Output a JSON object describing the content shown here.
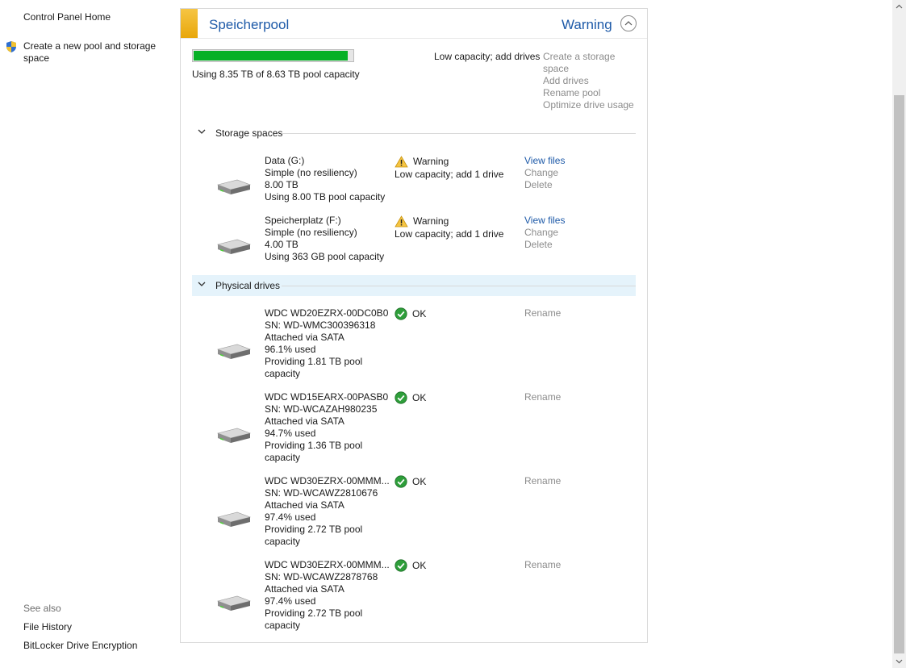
{
  "nav": {
    "home": "Control Panel Home",
    "create": "Create a new pool and storage space",
    "see_also": "See also",
    "file_history": "File History",
    "bitlocker": "BitLocker Drive Encryption"
  },
  "pool": {
    "title": "Speicherpool",
    "status": "Warning",
    "capacity_used_fraction": 0.968,
    "capacity_text": "Using 8.35 TB of 8.63 TB pool capacity",
    "low_capacity": "Low capacity; add drives",
    "actions": {
      "create_line1": "Create a storage",
      "create_line2": "space",
      "add_drives": "Add drives",
      "rename": "Rename pool",
      "optimize": "Optimize drive usage"
    }
  },
  "sections": {
    "storage_spaces": "Storage spaces",
    "physical_drives": "Physical drives"
  },
  "spaces": [
    {
      "name": "Data (G:)",
      "resiliency": "Simple (no resiliency)",
      "size": "8.00 TB",
      "usage": "Using 8.00 TB pool capacity",
      "status": "Warning",
      "status_detail": "Low capacity; add 1 drive",
      "view_files": "View files",
      "change": "Change",
      "delete": "Delete"
    },
    {
      "name": "Speicherplatz (F:)",
      "resiliency": "Simple (no resiliency)",
      "size": "4.00 TB",
      "usage": "Using 363 GB pool capacity",
      "status": "Warning",
      "status_detail": "Low capacity; add 1 drive",
      "view_files": "View files",
      "change": "Change",
      "delete": "Delete"
    }
  ],
  "drives": [
    {
      "model": "WDC WD20EZRX-00DC0B0",
      "serial": "SN: WD-WMC300396318",
      "attached": "Attached via SATA",
      "used": "96.1% used",
      "providing1": "Providing 1.81 TB pool",
      "providing2": "capacity",
      "status": "OK",
      "rename": "Rename"
    },
    {
      "model": "WDC WD15EARX-00PASB0",
      "serial": "SN: WD-WCAZAH980235",
      "attached": "Attached via SATA",
      "used": "94.7% used",
      "providing1": "Providing 1.36 TB pool",
      "providing2": "capacity",
      "status": "OK",
      "rename": "Rename"
    },
    {
      "model": "WDC WD30EZRX-00MMM...",
      "serial": "SN: WD-WCAWZ2810676",
      "attached": "Attached via SATA",
      "used": "97.4% used",
      "providing1": "Providing 2.72 TB pool",
      "providing2": "capacity",
      "status": "OK",
      "rename": "Rename"
    },
    {
      "model": "WDC WD30EZRX-00MMM...",
      "serial": "SN: WD-WCAWZ2878768",
      "attached": "Attached via SATA",
      "used": "97.4% used",
      "providing1": "Providing 2.72 TB pool",
      "providing2": "capacity",
      "status": "OK",
      "rename": "Rename"
    }
  ]
}
